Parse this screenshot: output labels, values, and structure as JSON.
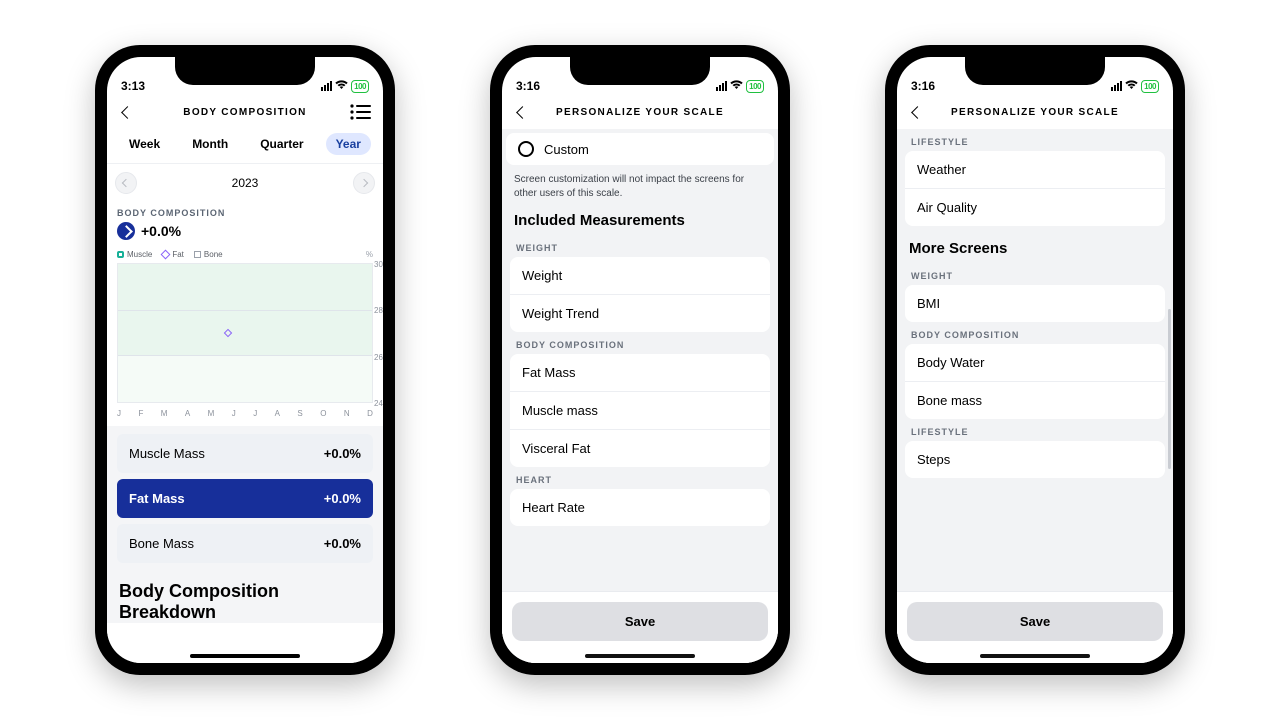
{
  "screens": [
    {
      "status_time": "3:13",
      "battery": "100",
      "title": "BODY COMPOSITION",
      "segments": [
        "Week",
        "Month",
        "Quarter",
        "Year"
      ],
      "active_segment": "Year",
      "year": "2023",
      "section_label": "BODY COMPOSITION",
      "delta": "+0.0%",
      "legend": {
        "muscle": "Muscle",
        "fat": "Fat",
        "bone": "Bone",
        "unit": "%"
      },
      "chart_data": {
        "type": "line",
        "title": "Body Composition",
        "ylabel": "%",
        "xlabel": "",
        "ylim": [
          24,
          30
        ],
        "yticks": [
          30,
          28,
          26,
          24
        ],
        "categories": [
          "J",
          "F",
          "M",
          "A",
          "M",
          "J",
          "J",
          "A",
          "S",
          "O",
          "N",
          "D"
        ],
        "series": [
          {
            "name": "Fat",
            "values": [
              null,
              null,
              null,
              null,
              null,
              27,
              null,
              null,
              null,
              null,
              null,
              null
            ]
          }
        ]
      },
      "metrics": [
        {
          "name": "Muscle Mass",
          "value": "+0.0%",
          "active": false
        },
        {
          "name": "Fat Mass",
          "value": "+0.0%",
          "active": true
        },
        {
          "name": "Bone Mass",
          "value": "+0.0%",
          "active": false
        }
      ],
      "breakdown_heading": "Body Composition Breakdown"
    },
    {
      "status_time": "3:16",
      "battery": "100",
      "title": "PERSONALIZE YOUR SCALE",
      "custom_label": "Custom",
      "desc": "Screen customization will not impact the screens for other users of this scale.",
      "included_heading": "Included Measurements",
      "groups": [
        {
          "label": "WEIGHT",
          "items": [
            "Weight",
            "Weight Trend"
          ]
        },
        {
          "label": "BODY COMPOSITION",
          "items": [
            "Fat Mass",
            "Muscle mass",
            "Visceral Fat"
          ]
        },
        {
          "label": "HEART",
          "items": [
            "Heart Rate"
          ]
        }
      ],
      "save_label": "Save"
    },
    {
      "status_time": "3:16",
      "battery": "100",
      "title": "PERSONALIZE YOUR SCALE",
      "top_group": {
        "label": "LIFESTYLE",
        "items": [
          "Weather",
          "Air Quality"
        ]
      },
      "more_heading": "More Screens",
      "groups": [
        {
          "label": "WEIGHT",
          "items": [
            "BMI"
          ]
        },
        {
          "label": "BODY COMPOSITION",
          "items": [
            "Body Water",
            "Bone mass"
          ]
        },
        {
          "label": "LIFESTYLE",
          "items": [
            "Steps"
          ]
        }
      ],
      "save_label": "Save"
    }
  ]
}
